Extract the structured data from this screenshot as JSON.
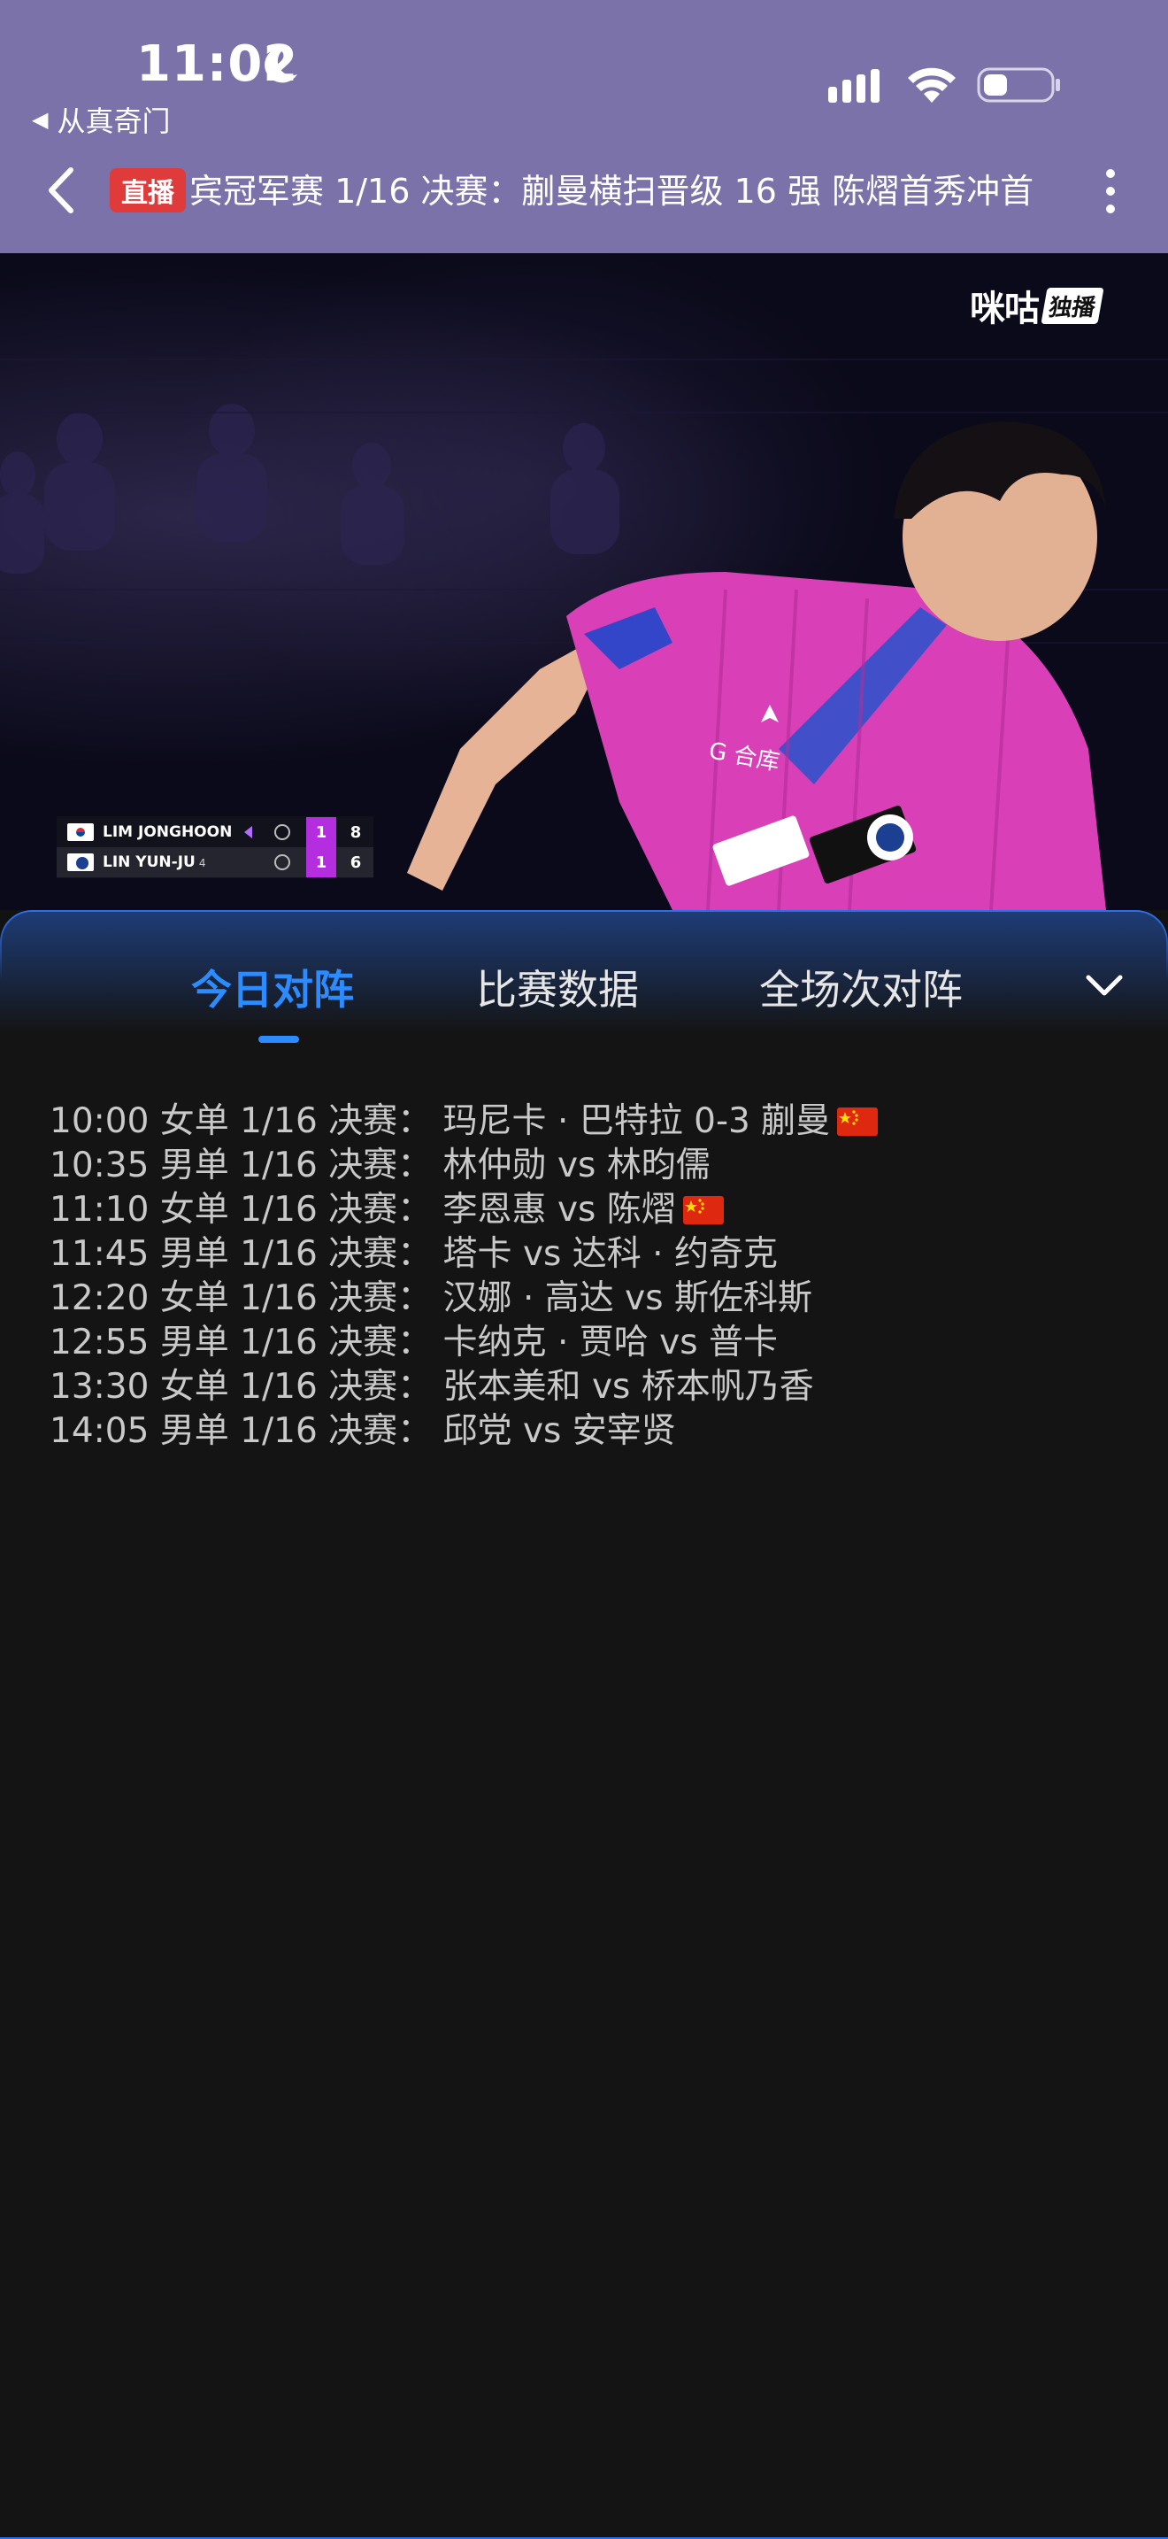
{
  "status_bar": {
    "time": "11:02",
    "back_app_label": "从真奇门"
  },
  "nav": {
    "live_badge": "直播",
    "title": "宾冠军赛 1/16 决赛：蒯曼横扫晋级 16 强 陈熠首秀冲首"
  },
  "video": {
    "watermark": "咪咕",
    "watermark_badge": "独播",
    "scoreboard": [
      {
        "player": "LIM JONGHOON",
        "seed": "",
        "games": "1",
        "points": "8",
        "serving": true
      },
      {
        "player": "LIN YUN-JU",
        "seed": "4",
        "games": "1",
        "points": "6",
        "serving": false
      }
    ]
  },
  "tabs": [
    {
      "label": "今日对阵",
      "active": true
    },
    {
      "label": "比赛数据",
      "active": false
    },
    {
      "label": "全场次对阵",
      "active": false
    }
  ],
  "schedule": [
    {
      "text": "10:00 女单 1/16 决赛：  玛尼卡 · 巴特拉 0-3 蒯曼",
      "flag": "china-flag"
    },
    {
      "text": "10:35 男单 1/16 决赛：  林仲勋 vs 林昀儒",
      "flag": ""
    },
    {
      "text": "11:10 女单 1/16 决赛：  李恩惠 vs 陈熠",
      "flag": "china-flag"
    },
    {
      "text": "11:45 男单 1/16 决赛：  塔卡 vs 达科 · 约奇克",
      "flag": ""
    },
    {
      "text": "12:20 女单 1/16 决赛：  汉娜 · 高达 vs 斯佐科斯",
      "flag": ""
    },
    {
      "text": "12:55 男单 1/16 决赛：  卡纳克 · 贾哈 vs 普卡",
      "flag": ""
    },
    {
      "text": "13:30 女单 1/16 决赛：  张本美和 vs 桥本帆乃香",
      "flag": ""
    },
    {
      "text": "14:05 男单 1/16 决赛：  邱党 vs 安宰贤",
      "flag": ""
    }
  ],
  "colors": {
    "header_bg": "#7a72a8",
    "accent": "#2c8cff",
    "live_badge": "#e03b3b",
    "jersey": "#d93fb6",
    "panel_bg": "#141414"
  }
}
